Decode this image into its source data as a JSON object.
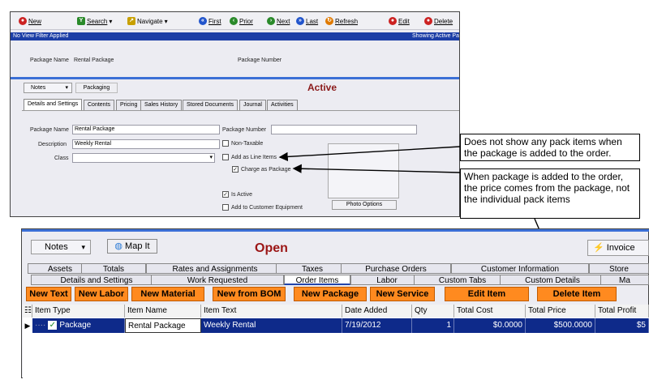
{
  "top_window": {
    "toolbar": [
      {
        "label": "New",
        "icon": "new-icon",
        "color": "#cc2222"
      },
      {
        "label": "Search",
        "icon": "search-icon",
        "color": "#2a8a2a",
        "dropdown": true
      },
      {
        "label": "Navigate",
        "icon": "navigate-icon",
        "color": "#c8a000",
        "dropdown": true
      },
      {
        "label": "First",
        "icon": "first-icon",
        "color": "#2255cc"
      },
      {
        "label": "Prior",
        "icon": "prior-icon",
        "color": "#2a8a2a"
      },
      {
        "label": "Next",
        "icon": "next-icon",
        "color": "#2a8a2a"
      },
      {
        "label": "Last",
        "icon": "last-icon",
        "color": "#2255cc"
      },
      {
        "label": "Refresh",
        "icon": "refresh-icon",
        "color": "#e07a00"
      },
      {
        "label": "Edit",
        "icon": "edit-icon",
        "color": "#cc2222"
      },
      {
        "label": "Delete",
        "icon": "delete-icon",
        "color": "#cc2222"
      }
    ],
    "filter_text": "No View Filter Applied",
    "showing_text": "Showing Active Pa",
    "header": {
      "name_label": "Package Name",
      "name_value": "Rental Package",
      "number_label": "Package Number"
    },
    "notes_label": "Notes",
    "packaging_label": "Packaging",
    "status": "Active",
    "tabs": [
      "Details and Settings",
      "Contents",
      "Pricing",
      "Sales History",
      "Stored Documents",
      "Journal",
      "Activities"
    ],
    "form": {
      "package_name_label": "Package Name",
      "package_name_value": "Rental Package",
      "description_label": "Description",
      "description_value": "Weekly Rental",
      "class_label": "Class",
      "package_number_label": "Package Number",
      "non_taxable": "Non-Taxable",
      "add_as_line_items": "Add as Line Items",
      "charge_as_package": "Charge as Package",
      "is_active": "Is Active",
      "add_to_customer_equipment": "Add to Customer Equipment",
      "photo_options": "Photo Options"
    }
  },
  "callouts": {
    "line_items": "Does not show any pack items when the package is added to the order.",
    "package_price": "When package is added to the order, the price comes from the package, not the individual pack items"
  },
  "bottom_window": {
    "notes_label": "Notes",
    "map_it_label": "Map It",
    "status": "Open",
    "invoice_label": "Invoice",
    "tabs_row1": [
      "Assets",
      "Totals",
      "Rates and Assignments",
      "Taxes",
      "Purchase Orders",
      "Customer Information",
      "Store"
    ],
    "tabs_row2": [
      "Details and Settings",
      "Work Requested",
      "Order Items",
      "Labor",
      "Custom Tabs",
      "Custom Details",
      "Ma"
    ],
    "action_buttons": [
      "New Text",
      "New Labor",
      "New Material",
      "New from BOM",
      "New Package",
      "New Service",
      "Edit Item",
      "Delete Item"
    ],
    "columns": [
      "Item Type",
      "Item Name",
      "Item Text",
      "Date Added",
      "Qty",
      "Total Cost",
      "Total Price",
      "Total Profit"
    ],
    "rows": [
      {
        "item_type": "Package",
        "item_name": "Rental Package",
        "item_text": "Weekly Rental",
        "date_added": "7/19/2012",
        "qty": "1",
        "total_cost": "$0.0000",
        "total_price": "$500.0000",
        "total_profit": "$5"
      }
    ]
  }
}
